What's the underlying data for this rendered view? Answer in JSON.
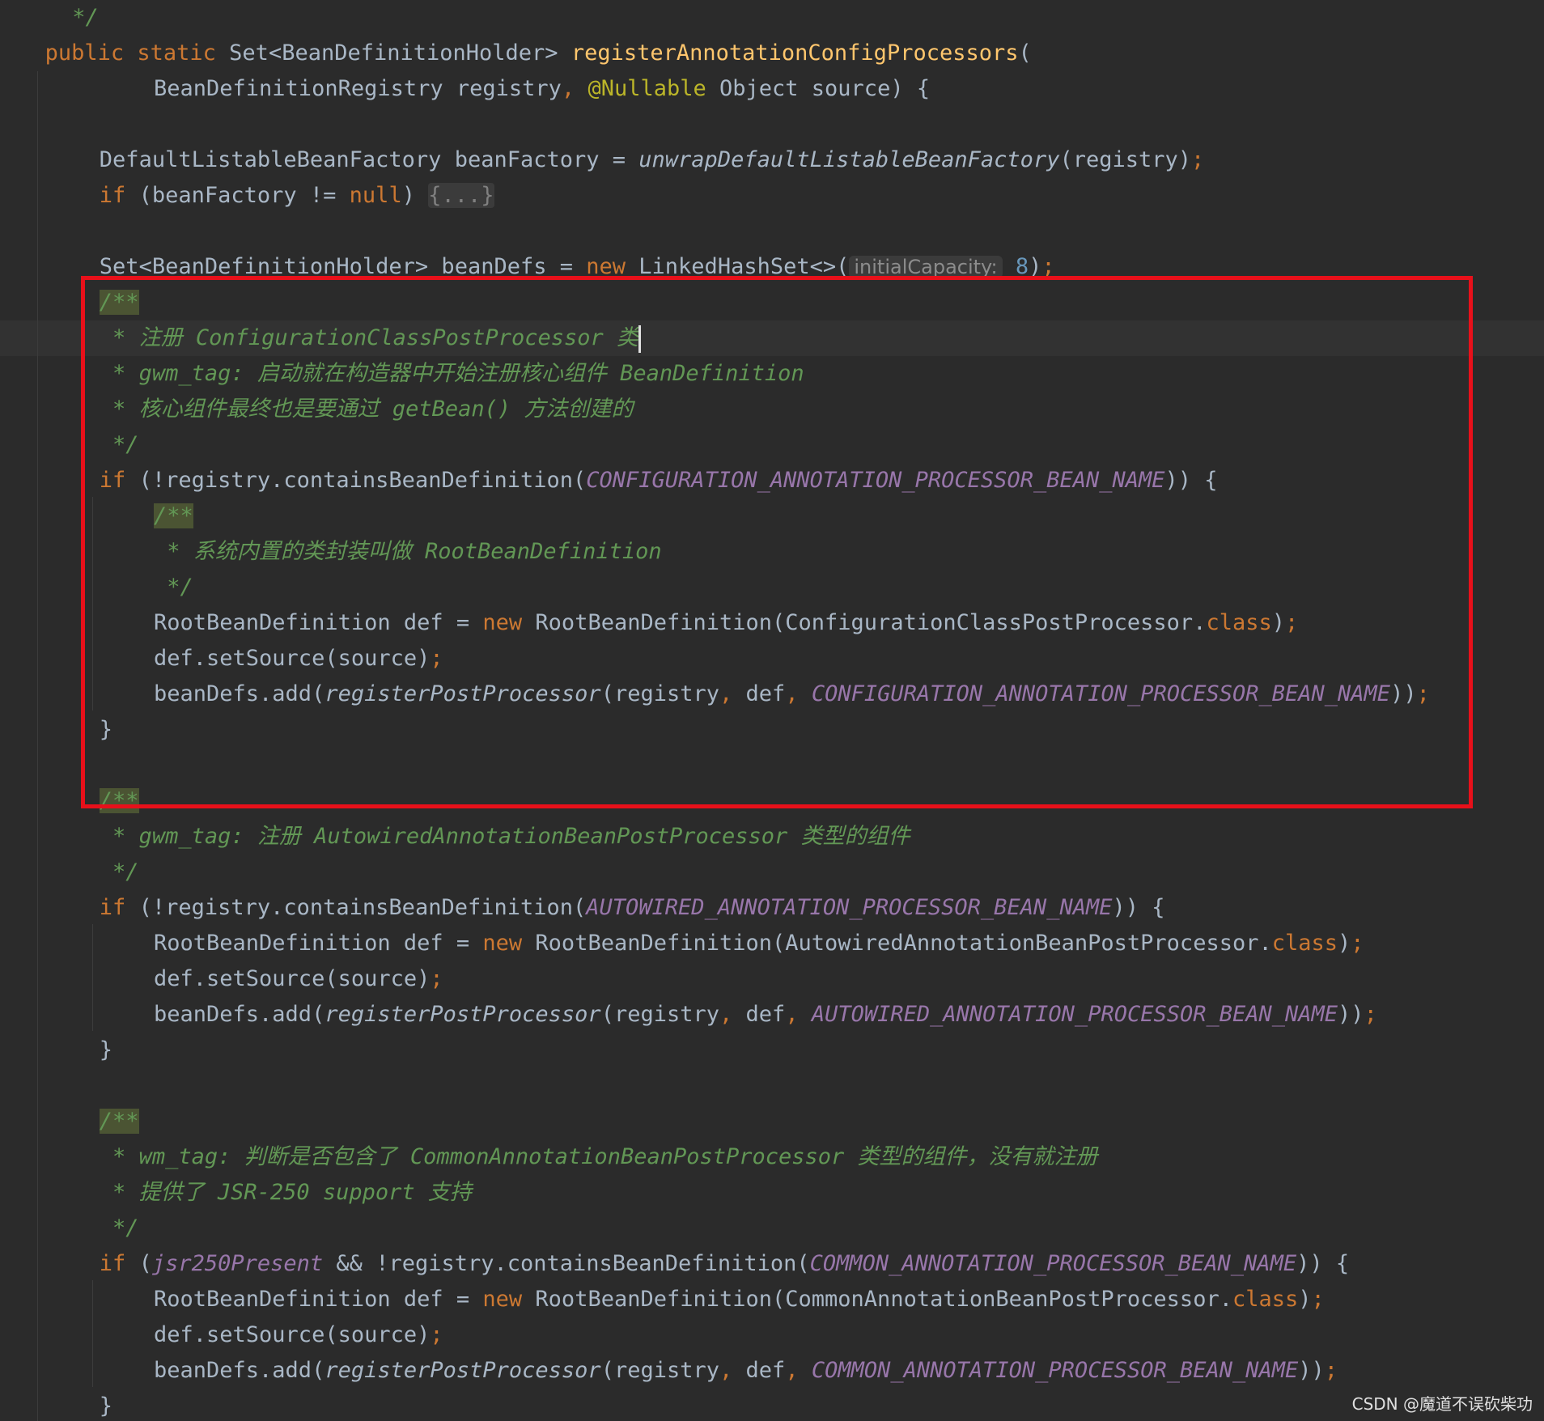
{
  "editor": {
    "theme_colors": {
      "background": "#2b2b2b",
      "keyword": "#cc7832",
      "text": "#a9b7c6",
      "method_declaration": "#ffc66d",
      "annotation": "#bbb529",
      "constant": "#9876aa",
      "comment": "#629755",
      "number": "#6897bb",
      "highlight_box": "#e8101a"
    },
    "lines": [
      {
        "indent": 2,
        "tokens": [
          {
            "t": "*/",
            "k": "comment"
          }
        ]
      },
      {
        "indent": 1,
        "tokens": [
          {
            "t": "public static ",
            "k": "kw"
          },
          {
            "t": "Set<BeanDefinitionHolder> ",
            "k": "plain"
          },
          {
            "t": "registerAnnotationConfigProcessors",
            "k": "method"
          },
          {
            "t": "(",
            "k": "plain"
          }
        ]
      },
      {
        "indent": 5,
        "tokens": [
          {
            "t": "BeanDefinitionRegistry registry",
            "k": "plain"
          },
          {
            "t": ", ",
            "k": "kw"
          },
          {
            "t": "@Nullable ",
            "k": "ann"
          },
          {
            "t": "Object source) {",
            "k": "plain"
          }
        ]
      },
      {
        "indent": 0,
        "tokens": []
      },
      {
        "indent": 3,
        "tokens": [
          {
            "t": "DefaultListableBeanFactory beanFactory = ",
            "k": "plain"
          },
          {
            "t": "unwrapDefaultListableBeanFactory",
            "k": "static-call"
          },
          {
            "t": "(registry)",
            "k": "plain"
          },
          {
            "t": ";",
            "k": "kw"
          }
        ]
      },
      {
        "indent": 3,
        "tokens": [
          {
            "t": "if ",
            "k": "kw"
          },
          {
            "t": "(beanFactory != ",
            "k": "plain"
          },
          {
            "t": "null",
            "k": "kw"
          },
          {
            "t": ") ",
            "k": "plain"
          },
          {
            "t": "{...}",
            "k": "fold"
          }
        ]
      },
      {
        "indent": 0,
        "tokens": []
      },
      {
        "indent": 3,
        "tokens": [
          {
            "t": "Set<BeanDefinitionHolder> beanDefs = ",
            "k": "plain"
          },
          {
            "t": "new ",
            "k": "kw"
          },
          {
            "t": "LinkedHashSet<>(",
            "k": "plain"
          },
          {
            "t": "initialCapacity:",
            "k": "hint"
          },
          {
            "t": " ",
            "k": "plain"
          },
          {
            "t": "8",
            "k": "number"
          },
          {
            "t": ")",
            "k": "plain"
          },
          {
            "t": ";",
            "k": "kw"
          }
        ]
      },
      {
        "indent": 3,
        "tokens": [
          {
            "t": "/**",
            "k": "doc-open"
          }
        ]
      },
      {
        "indent": 3,
        "current": true,
        "caret": true,
        "tokens": [
          {
            "t": " * 注册 ConfigurationClassPostProcessor 类",
            "k": "comment"
          }
        ]
      },
      {
        "indent": 3,
        "tokens": [
          {
            "t": " * gwm_tag: 启动就在构造器中开始注册核心组件 BeanDefinition",
            "k": "comment"
          }
        ]
      },
      {
        "indent": 3,
        "tokens": [
          {
            "t": " * 核心组件最终也是要通过 getBean() 方法创建的",
            "k": "comment"
          }
        ]
      },
      {
        "indent": 3,
        "tokens": [
          {
            "t": " */",
            "k": "comment"
          }
        ]
      },
      {
        "indent": 3,
        "tokens": [
          {
            "t": "if ",
            "k": "kw"
          },
          {
            "t": "(!registry.containsBeanDefinition(",
            "k": "plain"
          },
          {
            "t": "CONFIGURATION_ANNOTATION_PROCESSOR_BEAN_NAME",
            "k": "const"
          },
          {
            "t": ")) {",
            "k": "plain"
          }
        ]
      },
      {
        "indent": 5,
        "tokens": [
          {
            "t": "/**",
            "k": "doc-open"
          }
        ]
      },
      {
        "indent": 5,
        "tokens": [
          {
            "t": " * 系统内置的类封装叫做 RootBeanDefinition",
            "k": "comment"
          }
        ]
      },
      {
        "indent": 5,
        "tokens": [
          {
            "t": " */",
            "k": "comment"
          }
        ]
      },
      {
        "indent": 5,
        "tokens": [
          {
            "t": "RootBeanDefinition def = ",
            "k": "plain"
          },
          {
            "t": "new ",
            "k": "kw"
          },
          {
            "t": "RootBeanDefinition(ConfigurationClassPostProcessor.",
            "k": "plain"
          },
          {
            "t": "class",
            "k": "kw"
          },
          {
            "t": ")",
            "k": "plain"
          },
          {
            "t": ";",
            "k": "kw"
          }
        ]
      },
      {
        "indent": 5,
        "tokens": [
          {
            "t": "def.setSource(source)",
            "k": "plain"
          },
          {
            "t": ";",
            "k": "kw"
          }
        ]
      },
      {
        "indent": 5,
        "tokens": [
          {
            "t": "beanDefs.add(",
            "k": "plain"
          },
          {
            "t": "registerPostProcessor",
            "k": "static-call"
          },
          {
            "t": "(registry",
            "k": "plain"
          },
          {
            "t": ", ",
            "k": "kw"
          },
          {
            "t": "def",
            "k": "plain"
          },
          {
            "t": ", ",
            "k": "kw"
          },
          {
            "t": "CONFIGURATION_ANNOTATION_PROCESSOR_BEAN_NAME",
            "k": "const"
          },
          {
            "t": "))",
            "k": "plain"
          },
          {
            "t": ";",
            "k": "kw"
          }
        ]
      },
      {
        "indent": 3,
        "tokens": [
          {
            "t": "}",
            "k": "plain"
          }
        ]
      },
      {
        "indent": 0,
        "tokens": []
      },
      {
        "indent": 3,
        "tokens": [
          {
            "t": "/**",
            "k": "doc-open"
          }
        ]
      },
      {
        "indent": 3,
        "tokens": [
          {
            "t": " * gwm_tag: 注册 AutowiredAnnotationBeanPostProcessor 类型的组件",
            "k": "comment"
          }
        ]
      },
      {
        "indent": 3,
        "tokens": [
          {
            "t": " */",
            "k": "comment"
          }
        ]
      },
      {
        "indent": 3,
        "tokens": [
          {
            "t": "if ",
            "k": "kw"
          },
          {
            "t": "(!registry.containsBeanDefinition(",
            "k": "plain"
          },
          {
            "t": "AUTOWIRED_ANNOTATION_PROCESSOR_BEAN_NAME",
            "k": "const"
          },
          {
            "t": ")) {",
            "k": "plain"
          }
        ]
      },
      {
        "indent": 5,
        "tokens": [
          {
            "t": "RootBeanDefinition def = ",
            "k": "plain"
          },
          {
            "t": "new ",
            "k": "kw"
          },
          {
            "t": "RootBeanDefinition(AutowiredAnnotationBeanPostProcessor.",
            "k": "plain"
          },
          {
            "t": "class",
            "k": "kw"
          },
          {
            "t": ")",
            "k": "plain"
          },
          {
            "t": ";",
            "k": "kw"
          }
        ]
      },
      {
        "indent": 5,
        "tokens": [
          {
            "t": "def.setSource(source)",
            "k": "plain"
          },
          {
            "t": ";",
            "k": "kw"
          }
        ]
      },
      {
        "indent": 5,
        "tokens": [
          {
            "t": "beanDefs.add(",
            "k": "plain"
          },
          {
            "t": "registerPostProcessor",
            "k": "static-call"
          },
          {
            "t": "(registry",
            "k": "plain"
          },
          {
            "t": ", ",
            "k": "kw"
          },
          {
            "t": "def",
            "k": "plain"
          },
          {
            "t": ", ",
            "k": "kw"
          },
          {
            "t": "AUTOWIRED_ANNOTATION_PROCESSOR_BEAN_NAME",
            "k": "const"
          },
          {
            "t": "))",
            "k": "plain"
          },
          {
            "t": ";",
            "k": "kw"
          }
        ]
      },
      {
        "indent": 3,
        "tokens": [
          {
            "t": "}",
            "k": "plain"
          }
        ]
      },
      {
        "indent": 0,
        "tokens": []
      },
      {
        "indent": 3,
        "tokens": [
          {
            "t": "/**",
            "k": "doc-open"
          }
        ]
      },
      {
        "indent": 3,
        "tokens": [
          {
            "t": " * wm_tag: 判断是否包含了 CommonAnnotationBeanPostProcessor 类型的组件，没有就注册",
            "k": "comment"
          }
        ]
      },
      {
        "indent": 3,
        "tokens": [
          {
            "t": " * 提供了 JSR-250 support 支持",
            "k": "comment"
          }
        ]
      },
      {
        "indent": 3,
        "tokens": [
          {
            "t": " */",
            "k": "comment"
          }
        ]
      },
      {
        "indent": 3,
        "tokens": [
          {
            "t": "if ",
            "k": "kw"
          },
          {
            "t": "(",
            "k": "plain"
          },
          {
            "t": "jsr250Present ",
            "k": "const"
          },
          {
            "t": "&& !registry.containsBeanDefinition(",
            "k": "plain"
          },
          {
            "t": "COMMON_ANNOTATION_PROCESSOR_BEAN_NAME",
            "k": "const"
          },
          {
            "t": ")) {",
            "k": "plain"
          }
        ]
      },
      {
        "indent": 5,
        "tokens": [
          {
            "t": "RootBeanDefinition def = ",
            "k": "plain"
          },
          {
            "t": "new ",
            "k": "kw"
          },
          {
            "t": "RootBeanDefinition(CommonAnnotationBeanPostProcessor.",
            "k": "plain"
          },
          {
            "t": "class",
            "k": "kw"
          },
          {
            "t": ")",
            "k": "plain"
          },
          {
            "t": ";",
            "k": "kw"
          }
        ]
      },
      {
        "indent": 5,
        "tokens": [
          {
            "t": "def.setSource(source)",
            "k": "plain"
          },
          {
            "t": ";",
            "k": "kw"
          }
        ]
      },
      {
        "indent": 5,
        "tokens": [
          {
            "t": "beanDefs.add(",
            "k": "plain"
          },
          {
            "t": "registerPostProcessor",
            "k": "static-call"
          },
          {
            "t": "(registry",
            "k": "plain"
          },
          {
            "t": ", ",
            "k": "kw"
          },
          {
            "t": "def",
            "k": "plain"
          },
          {
            "t": ", ",
            "k": "kw"
          },
          {
            "t": "COMMON_ANNOTATION_PROCESSOR_BEAN_NAME",
            "k": "const"
          },
          {
            "t": "))",
            "k": "plain"
          },
          {
            "t": ";",
            "k": "kw"
          }
        ]
      },
      {
        "indent": 3,
        "tokens": [
          {
            "t": "}",
            "k": "plain"
          }
        ]
      }
    ]
  },
  "watermark": "CSDN @魔道不误砍柴功"
}
